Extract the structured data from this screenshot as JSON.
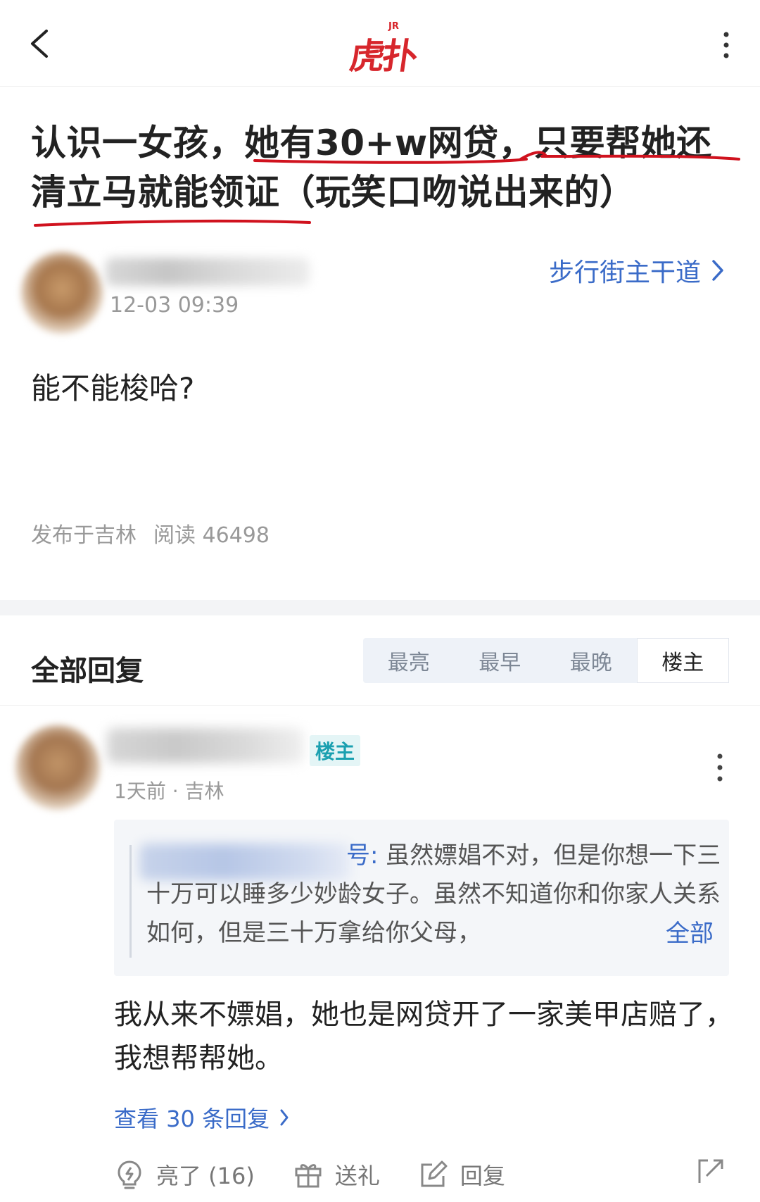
{
  "header": {
    "logo_badge": "JR",
    "logo_text": "虎扑"
  },
  "post": {
    "title": "认识一女孩，她有30+w网贷，只要帮她还清立马就能领证（玩笑口吻说出来的）",
    "time": "12-03 09:39",
    "board": "步行街主干道",
    "body": "能不能梭哈?",
    "location": "发布于吉林",
    "reads": "阅读 46498"
  },
  "replies": {
    "title": "全部回复",
    "sort_tabs": [
      {
        "label": "最亮"
      },
      {
        "label": "最早"
      },
      {
        "label": "最晚"
      },
      {
        "label": "楼主"
      }
    ],
    "active_tab": "楼主"
  },
  "reply": {
    "badge": "楼主",
    "meta": "1天前 · 吉林",
    "quote_name_tail": "号:",
    "quote_text": " 虽然嫖娼不对，但是你想一下三十万可以睡多少妙龄女子。虽然不知道你和你家人关系如何，但是三十万拿给你父母，",
    "quote_more": "全部",
    "body": "我从来不嫖娼，她也是网贷开了一家美甲店赔了，我想帮帮她。",
    "view_replies": "查看 30 条回复",
    "actions": {
      "like": "亮了 (16)",
      "gift": "送礼",
      "reply": "回复"
    }
  },
  "colors": {
    "brand_red": "#d7262c",
    "link_blue": "#3a6bc8",
    "op_badge": "#1aa0b0",
    "underline_red": "#d0121e"
  }
}
